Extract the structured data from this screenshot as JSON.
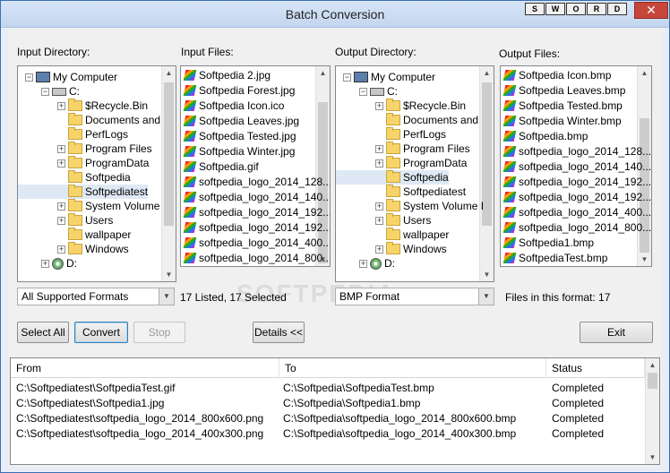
{
  "window": {
    "title": "Batch Conversion",
    "close_label": "✕"
  },
  "sword_letters": [
    "S",
    "W",
    "O",
    "R",
    "D"
  ],
  "labels": {
    "input_directory": "Input Directory:",
    "input_files": "Input Files:",
    "output_directory": "Output Directory:",
    "output_files": "Output Files:"
  },
  "input_tree": [
    {
      "label": "My Computer",
      "level": 0,
      "type": "pc",
      "expander": "−"
    },
    {
      "label": "C:",
      "level": 1,
      "type": "drive",
      "expander": "−"
    },
    {
      "label": "$Recycle.Bin",
      "level": 2,
      "type": "folder",
      "expander": "+"
    },
    {
      "label": "Documents and",
      "level": 2,
      "type": "folder",
      "expander": ""
    },
    {
      "label": "PerfLogs",
      "level": 2,
      "type": "folder",
      "expander": ""
    },
    {
      "label": "Program Files",
      "level": 2,
      "type": "folder",
      "expander": "+"
    },
    {
      "label": "ProgramData",
      "level": 2,
      "type": "folder",
      "expander": "+"
    },
    {
      "label": "Softpedia",
      "level": 2,
      "type": "folder",
      "expander": ""
    },
    {
      "label": "Softpediatest",
      "level": 2,
      "type": "folder",
      "expander": "",
      "selected": true
    },
    {
      "label": "System Volume",
      "level": 2,
      "type": "folder",
      "expander": "+"
    },
    {
      "label": "Users",
      "level": 2,
      "type": "folder",
      "expander": "+"
    },
    {
      "label": "wallpaper",
      "level": 2,
      "type": "folder",
      "expander": ""
    },
    {
      "label": "Windows",
      "level": 2,
      "type": "folder",
      "expander": "+"
    },
    {
      "label": "D:",
      "level": 1,
      "type": "cdrom",
      "expander": "+"
    }
  ],
  "input_files": [
    "Softpedia 2.jpg",
    "Softpedia Forest.jpg",
    "Softpedia Icon.ico",
    "Softpedia Leaves.jpg",
    "Softpedia Tested.jpg",
    "Softpedia Winter.jpg",
    "Softpedia.gif",
    "softpedia_logo_2014_128...",
    "softpedia_logo_2014_140...",
    "softpedia_logo_2014_192...",
    "softpedia_logo_2014_192...",
    "softpedia_logo_2014_400...",
    "softpedia_logo_2014_800..."
  ],
  "output_tree": [
    {
      "label": "My Computer",
      "level": 0,
      "type": "pc",
      "expander": "−"
    },
    {
      "label": "C:",
      "level": 1,
      "type": "drive",
      "expander": "−"
    },
    {
      "label": "$Recycle.Bin",
      "level": 2,
      "type": "folder",
      "expander": "+"
    },
    {
      "label": "Documents and",
      "level": 2,
      "type": "folder",
      "expander": ""
    },
    {
      "label": "PerfLogs",
      "level": 2,
      "type": "folder",
      "expander": ""
    },
    {
      "label": "Program Files",
      "level": 2,
      "type": "folder",
      "expander": "+"
    },
    {
      "label": "ProgramData",
      "level": 2,
      "type": "folder",
      "expander": "+"
    },
    {
      "label": "Softpedia",
      "level": 2,
      "type": "folder",
      "expander": "",
      "selected": true
    },
    {
      "label": "Softpediatest",
      "level": 2,
      "type": "folder",
      "expander": ""
    },
    {
      "label": "System Volume I",
      "level": 2,
      "type": "folder",
      "expander": "+"
    },
    {
      "label": "Users",
      "level": 2,
      "type": "folder",
      "expander": "+"
    },
    {
      "label": "wallpaper",
      "level": 2,
      "type": "folder",
      "expander": ""
    },
    {
      "label": "Windows",
      "level": 2,
      "type": "folder",
      "expander": "+"
    },
    {
      "label": "D:",
      "level": 1,
      "type": "cdrom",
      "expander": "+"
    }
  ],
  "output_files": [
    "Softpedia Icon.bmp",
    "Softpedia Leaves.bmp",
    "Softpedia Tested.bmp",
    "Softpedia Winter.bmp",
    "Softpedia.bmp",
    "softpedia_logo_2014_128...",
    "softpedia_logo_2014_140...",
    "softpedia_logo_2014_192...",
    "softpedia_logo_2014_192...",
    "softpedia_logo_2014_400...",
    "softpedia_logo_2014_800...",
    "Softpedia1.bmp",
    "SoftpediaTest.bmp"
  ],
  "input_format": {
    "value": "All Supported Formats"
  },
  "input_status": "17 Listed, 17 Selected",
  "output_format": {
    "value": "BMP Format"
  },
  "output_status": "Files in this format: 17",
  "buttons": {
    "select_all": "Select All",
    "convert": "Convert",
    "stop": "Stop",
    "details": "Details <<",
    "exit": "Exit"
  },
  "results": {
    "columns": [
      "From",
      "To",
      "Status"
    ],
    "rows": [
      [
        "C:\\Softpediatest\\SoftpediaTest.gif",
        "C:\\Softpedia\\SoftpediaTest.bmp",
        "Completed"
      ],
      [
        "C:\\Softpediatest\\Softpedia1.jpg",
        "C:\\Softpedia\\Softpedia1.bmp",
        "Completed"
      ],
      [
        "C:\\Softpediatest\\softpedia_logo_2014_800x600.png",
        "C:\\Softpedia\\softpedia_logo_2014_800x600.bmp",
        "Completed"
      ],
      [
        "C:\\Softpediatest\\softpedia_logo_2014_400x300.png",
        "C:\\Softpedia\\softpedia_logo_2014_400x300.bmp",
        "Completed"
      ]
    ]
  },
  "watermark": "SOFTPEDIA"
}
